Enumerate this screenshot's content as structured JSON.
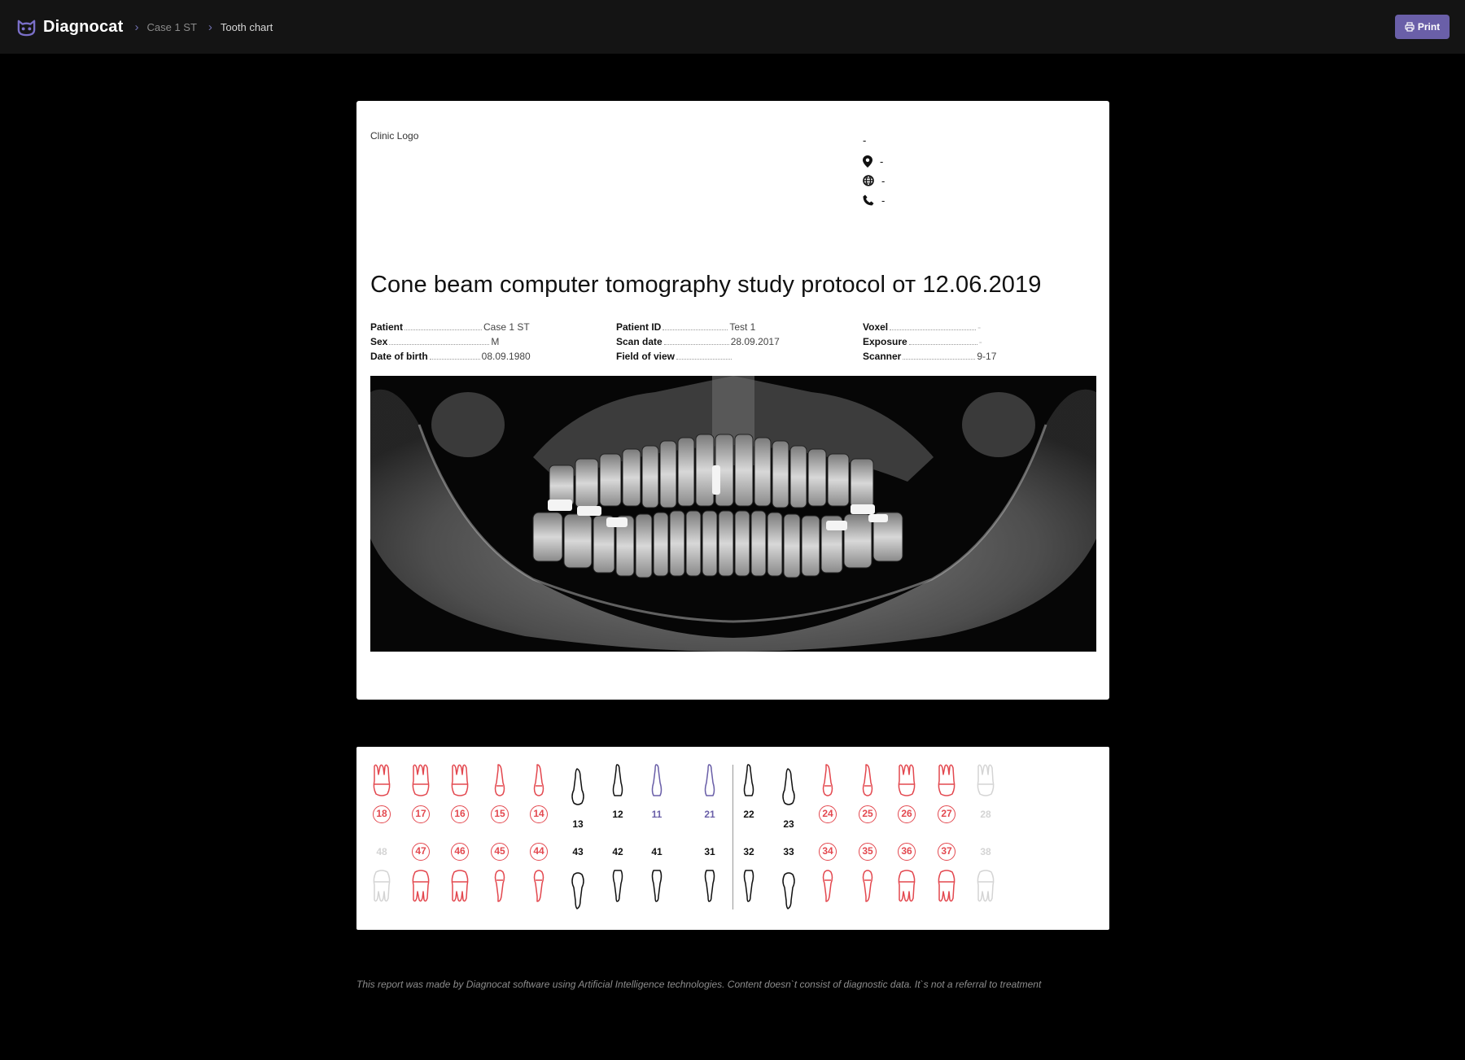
{
  "app": {
    "name": "Diagnocat",
    "brand_color": "#6a5fa8"
  },
  "breadcrumb": [
    "Case 1 ST",
    "Tooth chart"
  ],
  "toolbar": {
    "print_label": "Print",
    "print_icon": "printer-icon"
  },
  "report": {
    "clinic_logo_placeholder": "Clinic Logo",
    "clinic_name": "-",
    "address": "-",
    "website": "-",
    "phone": "-",
    "title": "Cone beam computer tomography study protocol от 12.06.2019",
    "fields": {
      "patient_label": "Patient",
      "patient": "Case 1 ST",
      "sex_label": "Sex",
      "sex": "M",
      "dob_label": "Date of birth",
      "dob": "08.09.1980",
      "patient_id_label": "Patient ID",
      "patient_id": "Test 1",
      "scan_date_label": "Scan date",
      "scan_date": "28.09.2017",
      "fov_label": "Field of view",
      "fov": "",
      "voxel_label": "Voxel",
      "voxel": "-",
      "exposure_label": "Exposure",
      "exposure": "-",
      "scanner_label": "Scanner",
      "scanner": "9-17"
    }
  },
  "tooth_chart": {
    "status_colors": {
      "red": "#e3484f",
      "black": "#111111",
      "purple": "#6a5fa8",
      "missing": "#d4d4d4"
    },
    "upper": [
      {
        "n": "18",
        "s": "red",
        "t": "molar"
      },
      {
        "n": "17",
        "s": "red",
        "t": "molar"
      },
      {
        "n": "16",
        "s": "red",
        "t": "molar"
      },
      {
        "n": "15",
        "s": "red",
        "t": "premolar"
      },
      {
        "n": "14",
        "s": "red",
        "t": "premolar"
      },
      {
        "n": "13",
        "s": "black",
        "t": "canine"
      },
      {
        "n": "12",
        "s": "black",
        "t": "incisor"
      },
      {
        "n": "11",
        "s": "purple",
        "t": "incisor"
      },
      {
        "n": "21",
        "s": "purple",
        "t": "incisor"
      },
      {
        "n": "22",
        "s": "black",
        "t": "incisor"
      },
      {
        "n": "23",
        "s": "black",
        "t": "canine"
      },
      {
        "n": "24",
        "s": "red",
        "t": "premolar"
      },
      {
        "n": "25",
        "s": "red",
        "t": "premolar"
      },
      {
        "n": "26",
        "s": "red",
        "t": "molar"
      },
      {
        "n": "27",
        "s": "red",
        "t": "molar"
      },
      {
        "n": "28",
        "s": "missing",
        "t": "molar"
      }
    ],
    "lower": [
      {
        "n": "48",
        "s": "missing",
        "t": "molar"
      },
      {
        "n": "47",
        "s": "red",
        "t": "molar"
      },
      {
        "n": "46",
        "s": "red",
        "t": "molar"
      },
      {
        "n": "45",
        "s": "red",
        "t": "premolar"
      },
      {
        "n": "44",
        "s": "red",
        "t": "premolar"
      },
      {
        "n": "43",
        "s": "black",
        "t": "canine"
      },
      {
        "n": "42",
        "s": "black",
        "t": "incisor"
      },
      {
        "n": "41",
        "s": "black",
        "t": "incisor"
      },
      {
        "n": "31",
        "s": "black",
        "t": "incisor"
      },
      {
        "n": "32",
        "s": "black",
        "t": "incisor"
      },
      {
        "n": "33",
        "s": "black",
        "t": "canine"
      },
      {
        "n": "34",
        "s": "red",
        "t": "premolar"
      },
      {
        "n": "35",
        "s": "red",
        "t": "premolar"
      },
      {
        "n": "36",
        "s": "red",
        "t": "molar"
      },
      {
        "n": "37",
        "s": "red",
        "t": "molar"
      },
      {
        "n": "38",
        "s": "missing",
        "t": "molar"
      }
    ]
  },
  "footer": "This report was made by Diagnocat software using Artificial Intelligence technologies. Content doesn`t consist of diagnostic data. It`s not a referral to treatment"
}
